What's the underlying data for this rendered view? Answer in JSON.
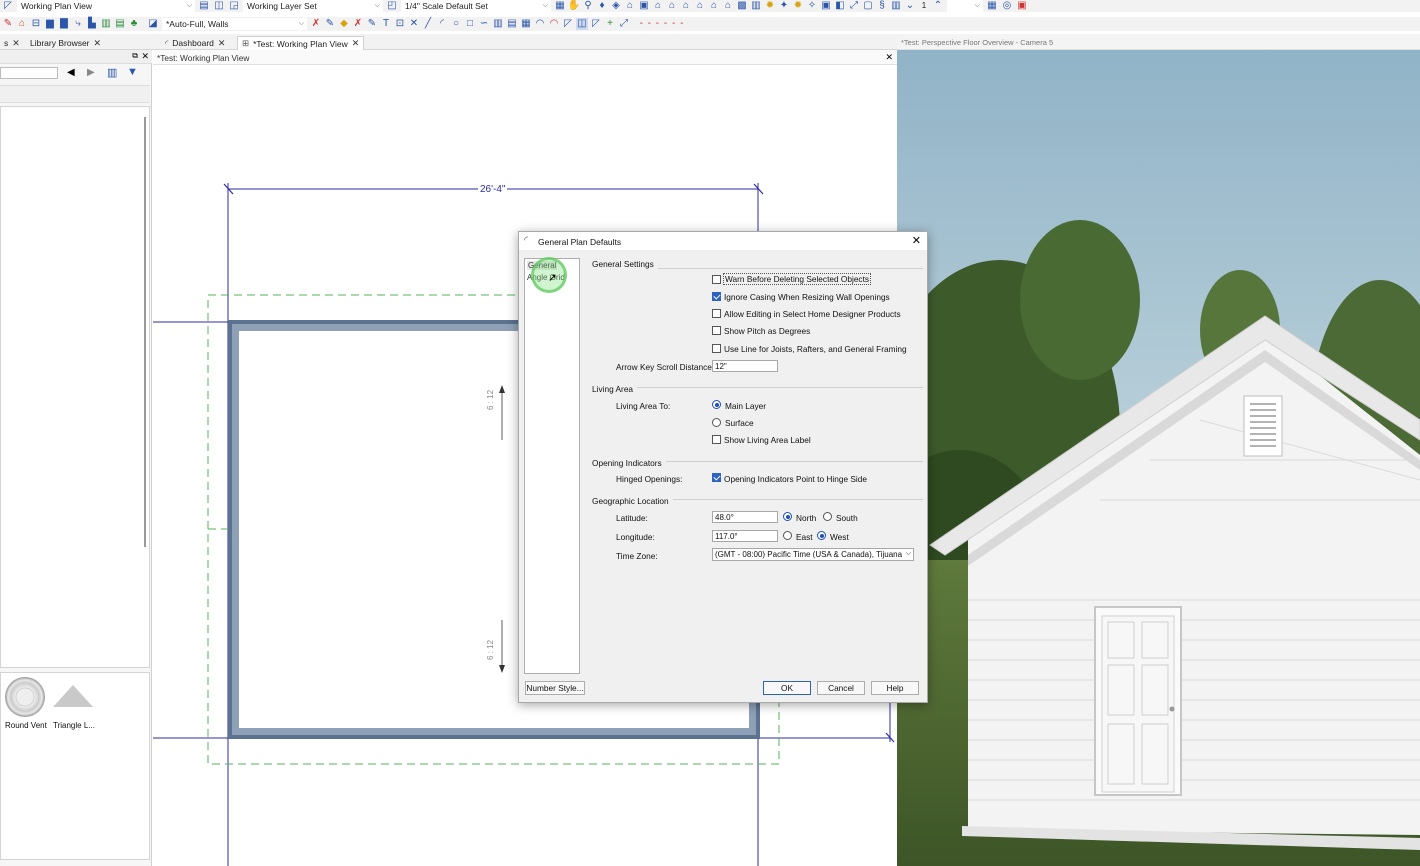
{
  "toolbar": {
    "plan_view_select": "Working Plan View",
    "layer_set_select": "Working Layer Set",
    "scale_select": "1/4\" Scale Default Set",
    "wall_type_select": "*Auto-Full, Walls",
    "zoom_value": "1"
  },
  "tabs": {
    "left_partial": "s",
    "library_browser": "Library Browser",
    "dashboard": "Dashboard",
    "plan_tab": "*Test:  Working Plan View",
    "camera_title": "*Test: Perspective Floor Overview - Camera 5"
  },
  "plan": {
    "title": "*Test:  Working Plan View",
    "dimension_top": "26'-4\"",
    "pitch_label_upper": "6 : 12",
    "pitch_label_lower": "6 : 12"
  },
  "library": {
    "items": [
      {
        "label": "Round Vent"
      },
      {
        "label": "Triangle L..."
      }
    ]
  },
  "dialog": {
    "title": "General Plan Defaults",
    "nav": [
      "General",
      "Angle Grid"
    ],
    "sections": {
      "general": "General Settings",
      "living": "Living Area",
      "opening": "Opening Indicators",
      "geo": "Geographic Location"
    },
    "checks": [
      {
        "label": "Warn Before Deleting Selected Objects",
        "checked": false
      },
      {
        "label": "Ignore Casing When Resizing Wall Openings",
        "checked": true
      },
      {
        "label": "Allow Editing in Select Home Designer Products",
        "checked": false
      },
      {
        "label": "Show Pitch as Degrees",
        "checked": false
      },
      {
        "label": "Use Line for Joists, Rafters, and General Framing",
        "checked": false
      }
    ],
    "arrow_key_label": "Arrow Key Scroll Distance:",
    "arrow_key_value": "12\"",
    "living_area_to_label": "Living Area To:",
    "living_main_layer": "Main Layer",
    "living_surface": "Surface",
    "show_living_label": "Show Living Area Label",
    "hinged_label": "Hinged Openings:",
    "hinged_option": "Opening Indicators Point to Hinge Side",
    "latitude_label": "Latitude:",
    "latitude_value": "48.0°",
    "north": "North",
    "south": "South",
    "longitude_label": "Longitude:",
    "longitude_value": "117.0°",
    "east": "East",
    "west": "West",
    "timezone_label": "Time Zone:",
    "timezone_value": "(GMT - 08:00) Pacific Time (USA & Canada), Tijuana",
    "number_style": "Number Style...",
    "ok": "OK",
    "cancel": "Cancel",
    "help": "Help"
  },
  "colors": {
    "wall": "#5b7290",
    "dimension": "#2b2ba6",
    "guide": "#56b35a",
    "accent": "#2d62c3"
  }
}
